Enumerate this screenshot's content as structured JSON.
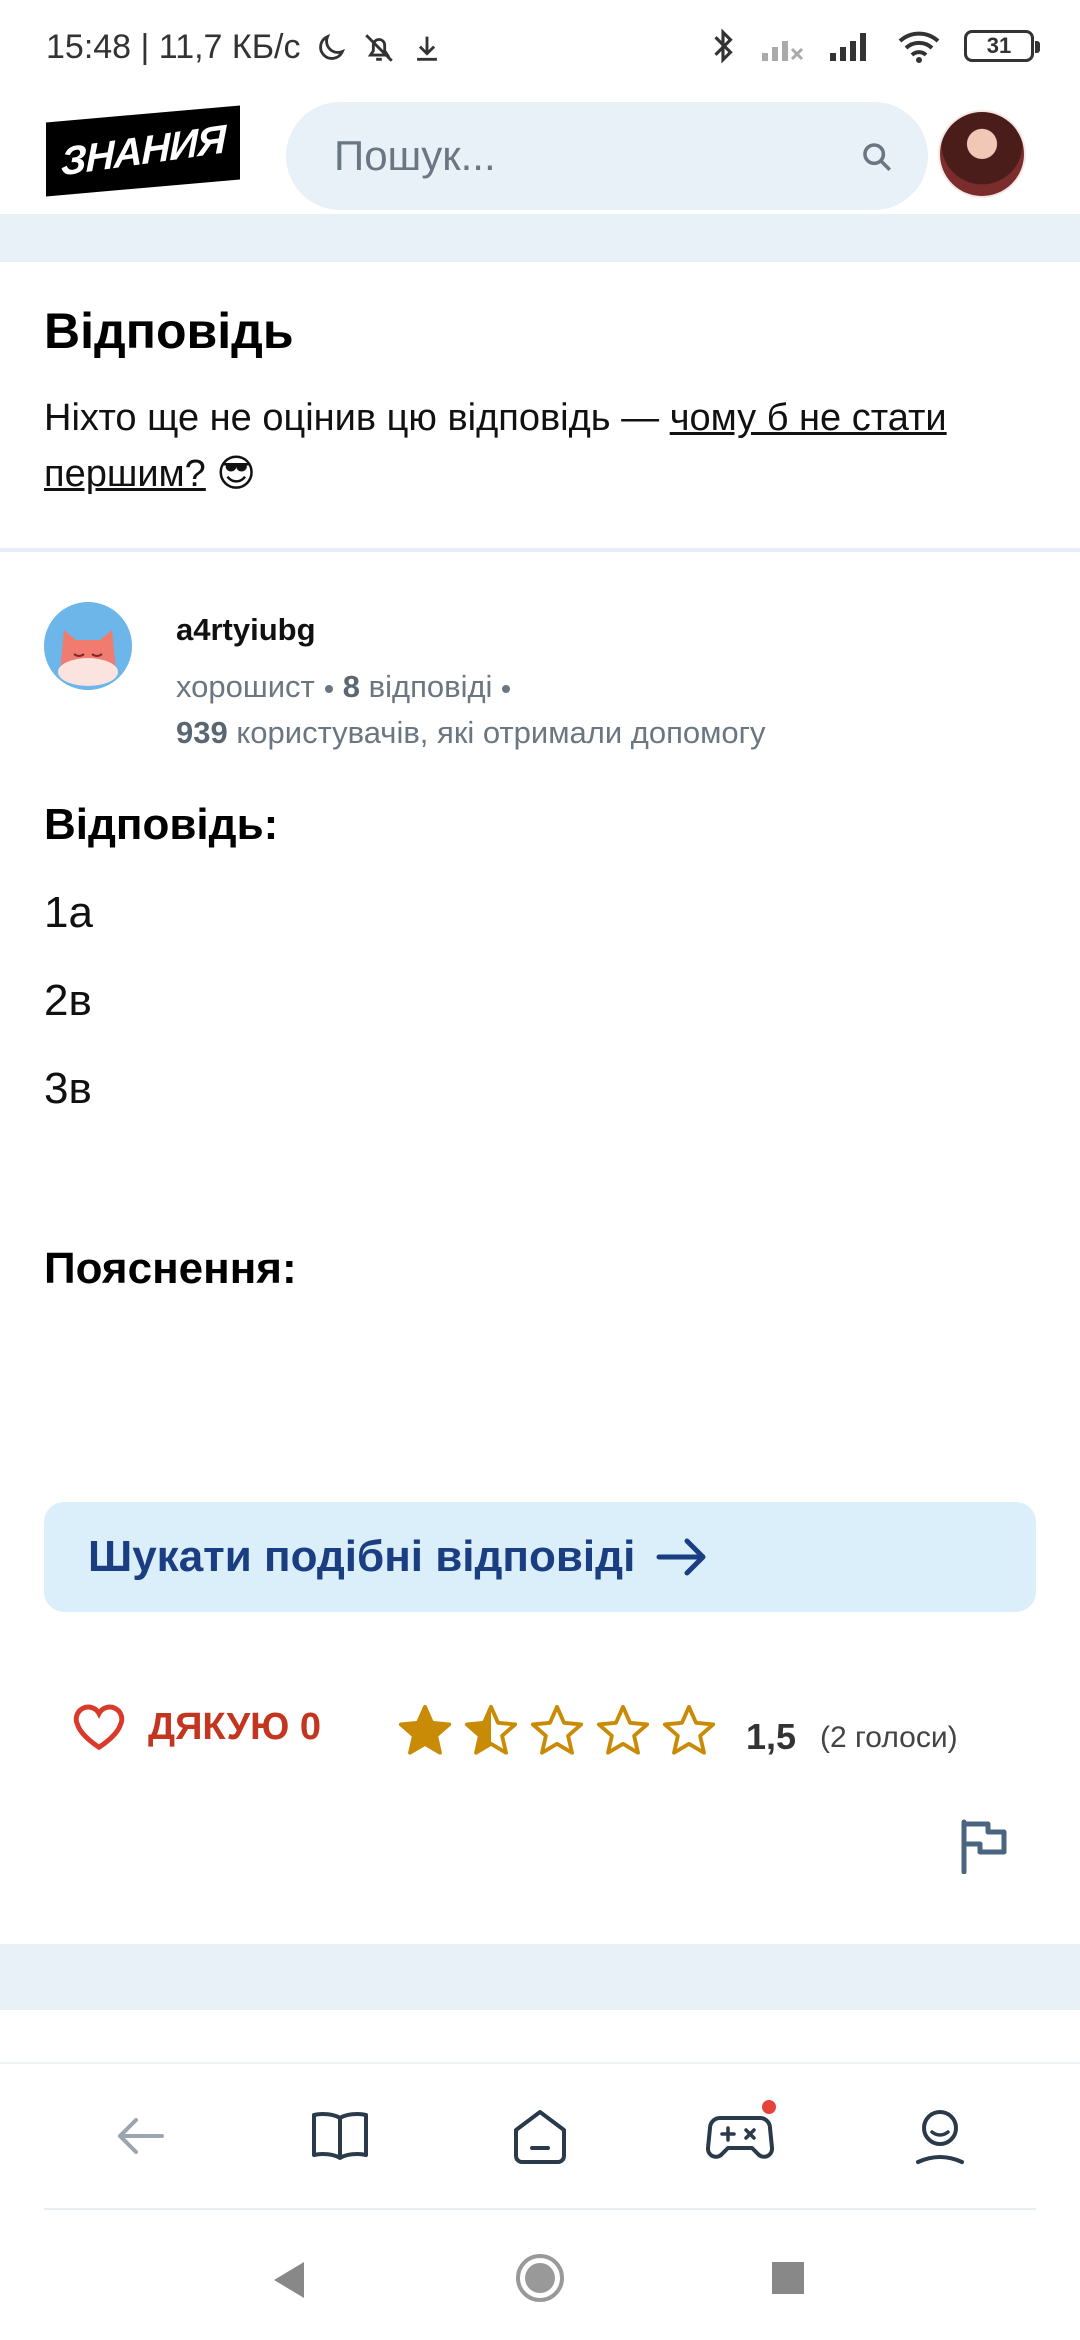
{
  "status_bar": {
    "time_speed": "15:48 | 11,7 КБ/с",
    "battery": "31"
  },
  "header": {
    "logo": "ЗНАНИЯ",
    "search_placeholder": "Пошук..."
  },
  "answer_section": {
    "title": "Відповідь",
    "note_prefix": "Ніхто ще не оцінив цю відповідь — ",
    "note_link": "чому б не стати першим?",
    "note_emoji": "😎"
  },
  "author": {
    "name": "a4rtyiubg",
    "rank": "хорошист",
    "answers_count": "8",
    "answers_label": "відповіді",
    "helped_count": "939",
    "helped_label": "користувачів, які отримали допомогу"
  },
  "content": {
    "answer_heading": "Відповідь:",
    "answers": [
      "1а",
      "2в",
      "3в"
    ],
    "explanation_heading": "Пояснення:"
  },
  "similar_button": {
    "label": "Шукати подібні відповіді"
  },
  "rating": {
    "thanks_label": "ДЯКУЮ 0",
    "value": "1,5",
    "votes": "(2 голоси)",
    "stars_filled": 1.5,
    "stars_total": 5
  },
  "colors": {
    "accent_blue": "#1b3e82",
    "thanks_red": "#c3351e",
    "star_gold": "#c98b06",
    "band_blue": "#e8f0f8"
  }
}
